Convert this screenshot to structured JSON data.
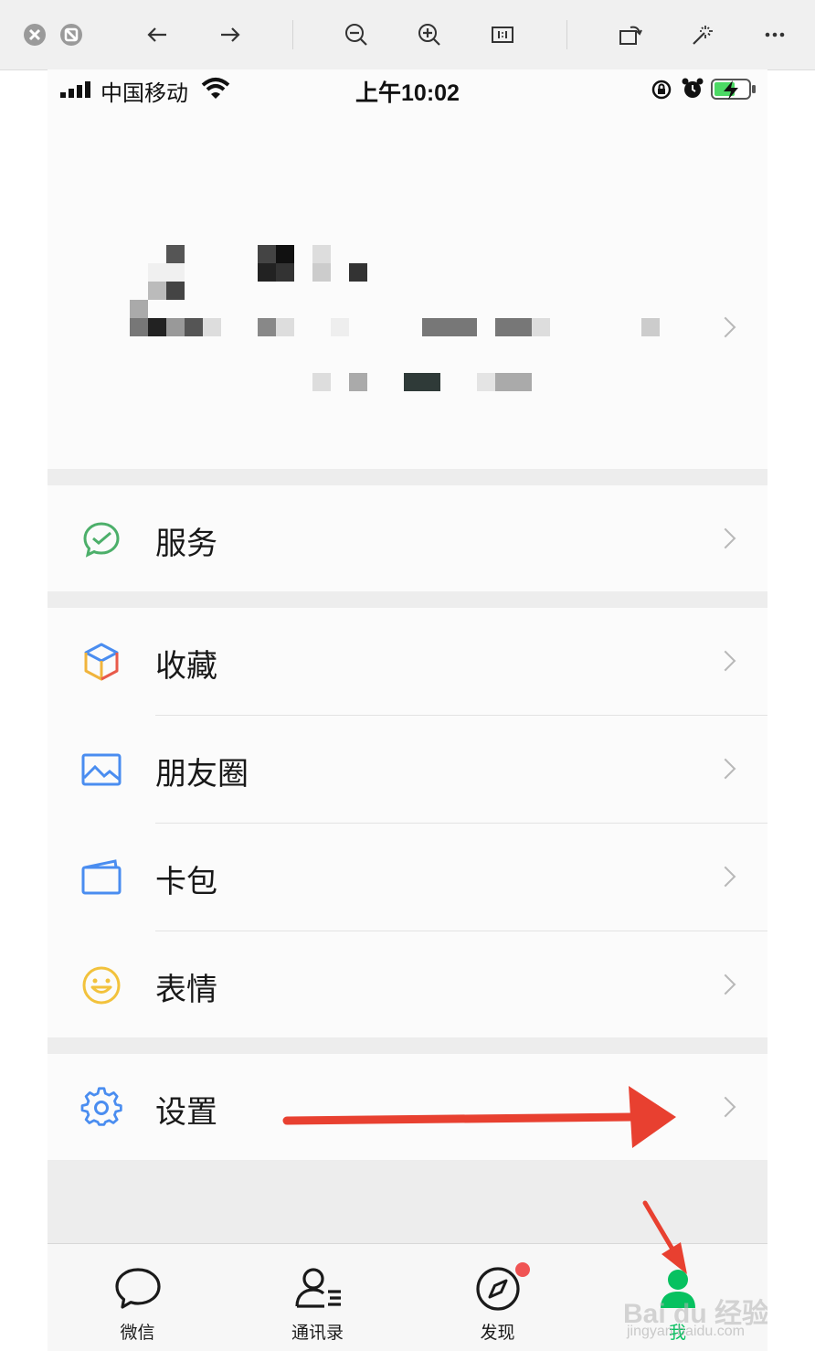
{
  "statusbar": {
    "carrier": "中国移动",
    "time": "上午10:02"
  },
  "menu": {
    "service": "服务",
    "favorites": "收藏",
    "moments": "朋友圈",
    "cards": "卡包",
    "stickers": "表情",
    "settings": "设置"
  },
  "tabs": {
    "chats": "微信",
    "contacts": "通讯录",
    "discover": "发现",
    "me": "我"
  },
  "watermark": {
    "brand": "Bai du 经验",
    "url": "jingyan.baidu.com"
  },
  "colors": {
    "accent_green": "#07c160",
    "annotation_red": "#e84030",
    "badge_red": "#f05454"
  }
}
